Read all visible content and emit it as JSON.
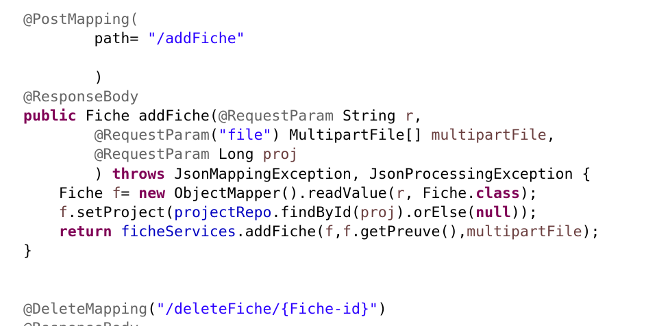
{
  "editor": {
    "lines": [
      [
        {
          "t": "@PostMapping(",
          "c": "ann"
        }
      ],
      [
        {
          "t": "        path= ",
          "c": "cls"
        },
        {
          "t": "\"/addFiche\"",
          "c": "str"
        }
      ],
      [
        {
          "t": "",
          "c": "cls"
        }
      ],
      [
        {
          "t": "        )",
          "c": "cls"
        }
      ],
      [
        {
          "t": "@ResponseBody",
          "c": "ann"
        }
      ],
      [
        {
          "t": "public",
          "c": "kw"
        },
        {
          "t": " Fiche addFiche(",
          "c": "cls"
        },
        {
          "t": "@RequestParam",
          "c": "ann"
        },
        {
          "t": " String ",
          "c": "cls"
        },
        {
          "t": "r",
          "c": "prm"
        },
        {
          "t": ",",
          "c": "cls"
        }
      ],
      [
        {
          "t": "        ",
          "c": "cls"
        },
        {
          "t": "@RequestParam",
          "c": "ann"
        },
        {
          "t": "(",
          "c": "cls"
        },
        {
          "t": "\"file\"",
          "c": "str"
        },
        {
          "t": ") MultipartFile[] ",
          "c": "cls"
        },
        {
          "t": "multipartFile",
          "c": "prm"
        },
        {
          "t": ",",
          "c": "cls"
        }
      ],
      [
        {
          "t": "        ",
          "c": "cls"
        },
        {
          "t": "@RequestParam",
          "c": "ann"
        },
        {
          "t": " Long ",
          "c": "cls"
        },
        {
          "t": "proj",
          "c": "prm"
        }
      ],
      [
        {
          "t": "        ) ",
          "c": "cls"
        },
        {
          "t": "throws",
          "c": "kw"
        },
        {
          "t": " JsonMappingException, JsonProcessingException {",
          "c": "cls"
        }
      ],
      [
        {
          "t": "    Fiche ",
          "c": "cls"
        },
        {
          "t": "f",
          "c": "prm"
        },
        {
          "t": "= ",
          "c": "cls"
        },
        {
          "t": "new",
          "c": "kw"
        },
        {
          "t": " ObjectMapper().readValue(",
          "c": "cls"
        },
        {
          "t": "r",
          "c": "prm"
        },
        {
          "t": ", Fiche.",
          "c": "cls"
        },
        {
          "t": "class",
          "c": "kw"
        },
        {
          "t": ");",
          "c": "cls"
        }
      ],
      [
        {
          "t": "    ",
          "c": "cls"
        },
        {
          "t": "f",
          "c": "prm"
        },
        {
          "t": ".setProject(",
          "c": "cls"
        },
        {
          "t": "projectRepo",
          "c": "fld"
        },
        {
          "t": ".findById(",
          "c": "cls"
        },
        {
          "t": "proj",
          "c": "prm"
        },
        {
          "t": ").orElse(",
          "c": "cls"
        },
        {
          "t": "null",
          "c": "kw"
        },
        {
          "t": "));",
          "c": "cls"
        }
      ],
      [
        {
          "t": "    ",
          "c": "cls"
        },
        {
          "t": "return",
          "c": "kw"
        },
        {
          "t": " ",
          "c": "cls"
        },
        {
          "t": "ficheServices",
          "c": "fld"
        },
        {
          "t": ".addFiche(",
          "c": "cls"
        },
        {
          "t": "f",
          "c": "prm"
        },
        {
          "t": ",",
          "c": "cls"
        },
        {
          "t": "f",
          "c": "prm"
        },
        {
          "t": ".getPreuve(),",
          "c": "cls"
        },
        {
          "t": "multipartFile",
          "c": "prm"
        },
        {
          "t": ");",
          "c": "cls"
        }
      ],
      [
        {
          "t": "}",
          "c": "cls"
        }
      ],
      [
        {
          "t": "",
          "c": "cls"
        }
      ],
      [
        {
          "t": "",
          "c": "cls"
        }
      ],
      [
        {
          "t": "@DeleteMapping",
          "c": "ann"
        },
        {
          "t": "(",
          "c": "cls"
        },
        {
          "t": "\"/deleteFiche/{Fiche-id}\"",
          "c": "str"
        },
        {
          "t": ")",
          "c": "cls"
        }
      ],
      [
        {
          "t": "@ResponseBody",
          "c": "ann"
        }
      ]
    ]
  }
}
